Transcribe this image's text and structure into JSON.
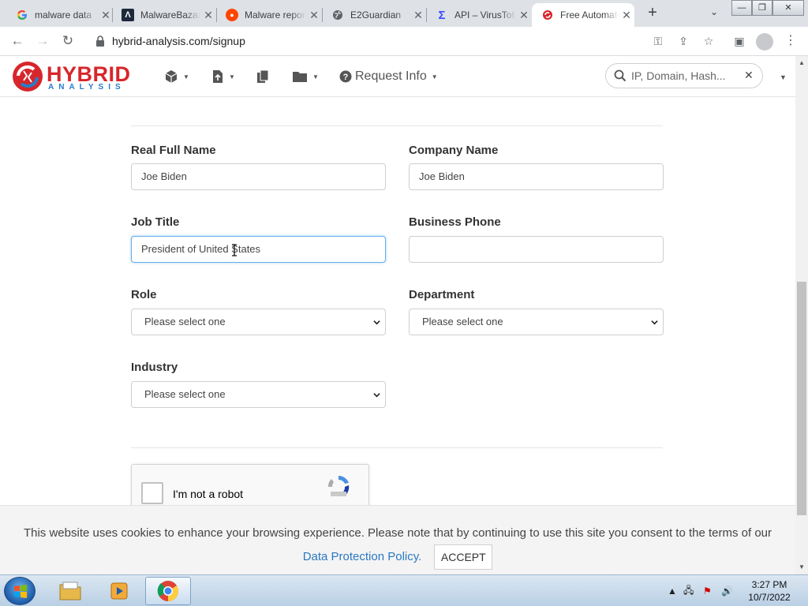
{
  "browser": {
    "tabs": [
      {
        "title": "malware data",
        "icon": "google-icon",
        "active": false
      },
      {
        "title": "MalwareBazaar",
        "icon": "malwarebazaar-icon",
        "active": false
      },
      {
        "title": "Malware reports",
        "icon": "reddit-icon",
        "active": false
      },
      {
        "title": "E2Guardian",
        "icon": "globe-icon",
        "active": false
      },
      {
        "title": "API – VirusTotal",
        "icon": "virustotal-icon",
        "active": false
      },
      {
        "title": "Free Automated",
        "icon": "hybrid-analysis-icon",
        "active": true
      }
    ],
    "url": "hybrid-analysis.com/signup"
  },
  "site": {
    "logo_text": "HYBRID",
    "logo_subtext": "ANALYSIS",
    "nav": {
      "request_info": "Request Info"
    },
    "search": {
      "placeholder": "IP, Domain, Hash..."
    }
  },
  "form": {
    "real_full_name": {
      "label": "Real Full Name",
      "value": "Joe Biden"
    },
    "company_name": {
      "label": "Company Name",
      "value": "Joe Biden"
    },
    "job_title": {
      "label": "Job Title",
      "value": "President of United States"
    },
    "business_phone": {
      "label": "Business Phone",
      "value": ""
    },
    "role": {
      "label": "Role",
      "selected": "Please select one"
    },
    "department": {
      "label": "Department",
      "selected": "Please select one"
    },
    "industry": {
      "label": "Industry",
      "selected": "Please select one"
    },
    "captcha": {
      "label": "I'm not a robot"
    }
  },
  "cookie_banner": {
    "message": "This website uses cookies to enhance your browsing experience. Please note that by continuing to use this site you consent to the terms of our ",
    "link_text": "Data Protection Policy.",
    "accept_label": "ACCEPT"
  },
  "taskbar": {
    "time": "3:27 PM",
    "date": "10/7/2022"
  }
}
